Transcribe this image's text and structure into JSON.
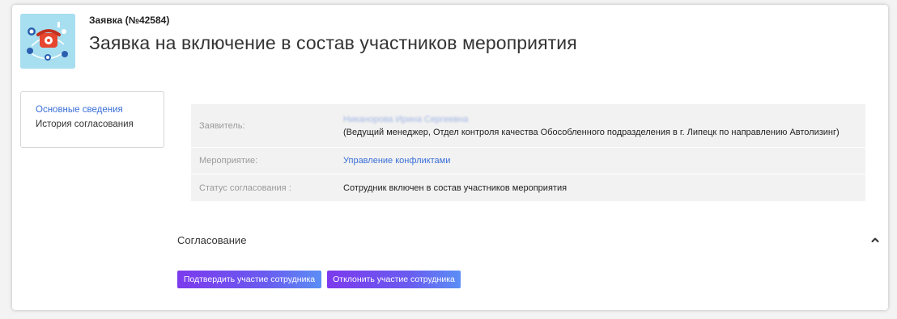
{
  "header": {
    "subtitle": "Заявка (№42584)",
    "title": "Заявка на включение в состав участников мероприятия"
  },
  "sidenav": {
    "items": [
      {
        "label": "Основные сведения",
        "active": true
      },
      {
        "label": "История согласования",
        "active": false
      }
    ]
  },
  "details": {
    "applicant_label": "Заявитель:",
    "applicant_name": "Никанорова Ирина Сергеевна",
    "applicant_position": "(Ведущий менеджер, Отдел контроля качества Обособленного подразделения в г. Липецк по направлению Автолизинг)",
    "event_label": "Мероприятие:",
    "event_value": "Управление конфликтами",
    "status_label": "Статус согласования :",
    "status_value": "Сотрудник включен в состав участников мероприятия"
  },
  "approval": {
    "section_title": "Согласование",
    "confirm_label": "Подтвердить участие сотрудника",
    "reject_label": "Отклонить участие сотрудника"
  },
  "colors": {
    "accent": "#3a6fd6",
    "button_gradient_start": "#7c3aed",
    "button_gradient_end": "#5b8ef5",
    "icon_bg": "#a7dff0"
  },
  "icons": {
    "app_icon": "telephone-network-icon",
    "collapse": "chevron-up-icon"
  }
}
